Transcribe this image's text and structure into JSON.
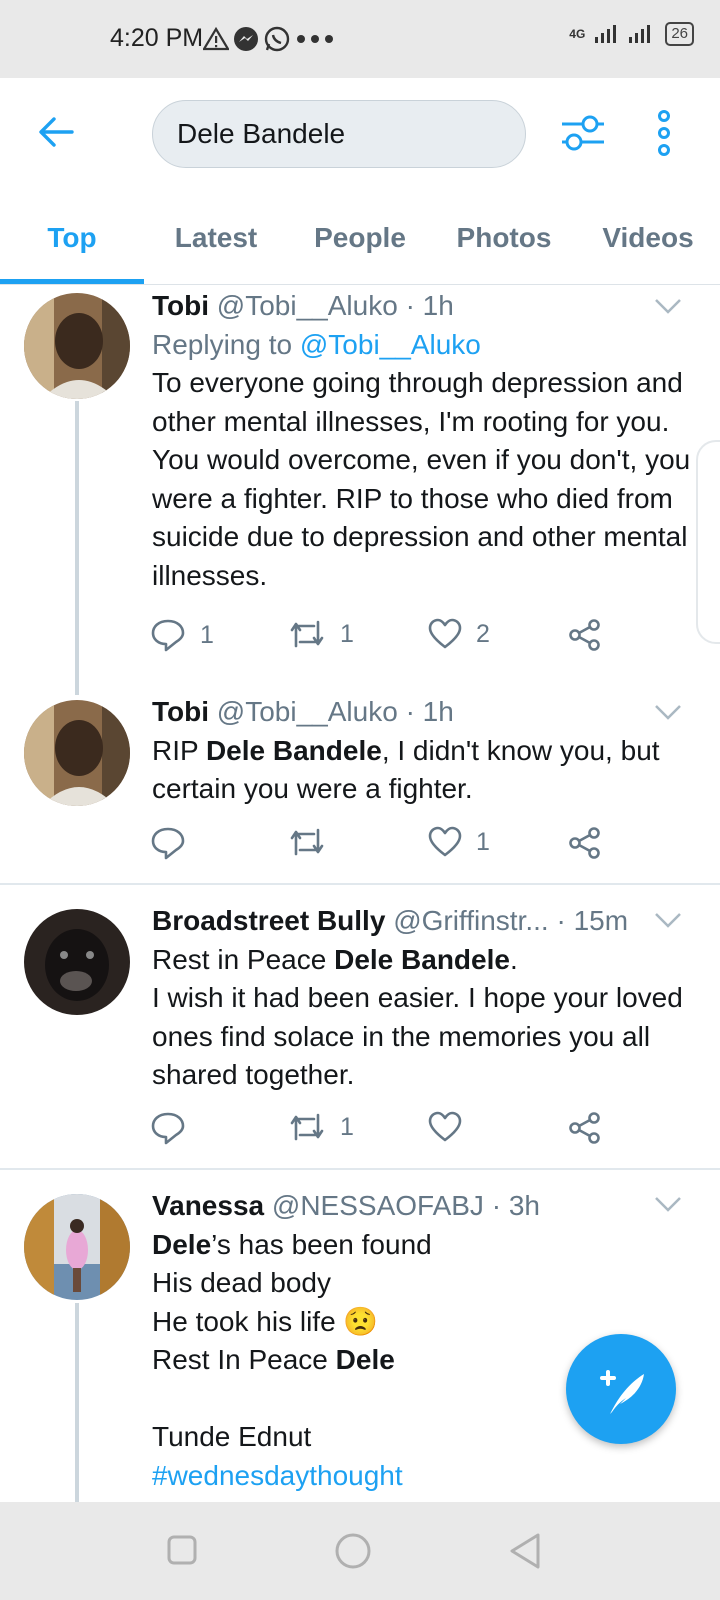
{
  "status_bar": {
    "time": "4:20 PM",
    "network": "4G",
    "battery": "26"
  },
  "search": {
    "query": "Dele Bandele"
  },
  "tabs": [
    {
      "label": "Top",
      "active": true
    },
    {
      "label": "Latest",
      "active": false
    },
    {
      "label": "People",
      "active": false
    },
    {
      "label": "Photos",
      "active": false
    },
    {
      "label": "Videos",
      "active": false
    }
  ],
  "tweets": [
    {
      "name": "Tobi",
      "handle": "@Tobi__Aluko",
      "time": "· 1h",
      "replying_prefix": "Replying to ",
      "replying_handle": "@Tobi__Aluko",
      "text": "To everyone going through depression and other mental illnesses, I'm rooting for you. You would overcome, even if you don't, you were a fighter. RIP to those who died from suicide due to depression and other mental illnesses.",
      "replies": "1",
      "retweets": "1",
      "likes": "2"
    },
    {
      "name": "Tobi",
      "handle": "@Tobi__Aluko",
      "time": "· 1h",
      "text_pre": "RIP ",
      "text_bold": "Dele Bandele",
      "text_post": ", I didn't know you, but certain you were a fighter.",
      "replies": "",
      "retweets": "",
      "likes": "1"
    },
    {
      "name": "Broadstreet Bully",
      "handle": "@Griffinstr...",
      "time": "· 15m",
      "line1_pre": "Rest in Peace ",
      "line1_bold": "Dele Bandele",
      "line1_post": ".",
      "text": "I wish it had been easier. I hope your loved ones find solace in the memories you all shared together.",
      "replies": "",
      "retweets": "1",
      "likes": ""
    },
    {
      "name": "Vanessa",
      "handle": "@NESSAOFABJ",
      "time": "· 3h",
      "line1_bold": "Dele",
      "line1_post": "’s has been found",
      "line2": "His dead body",
      "line3": "He took his life 😟",
      "line4_pre": "Rest In Peace ",
      "line4_bold": "Dele",
      "line5": "Tunde Ednut",
      "hashtag": "#wednesdaythought"
    }
  ],
  "colors": {
    "accent": "#1da1f2",
    "secondary_text": "#657786",
    "primary_text": "#14171a"
  }
}
